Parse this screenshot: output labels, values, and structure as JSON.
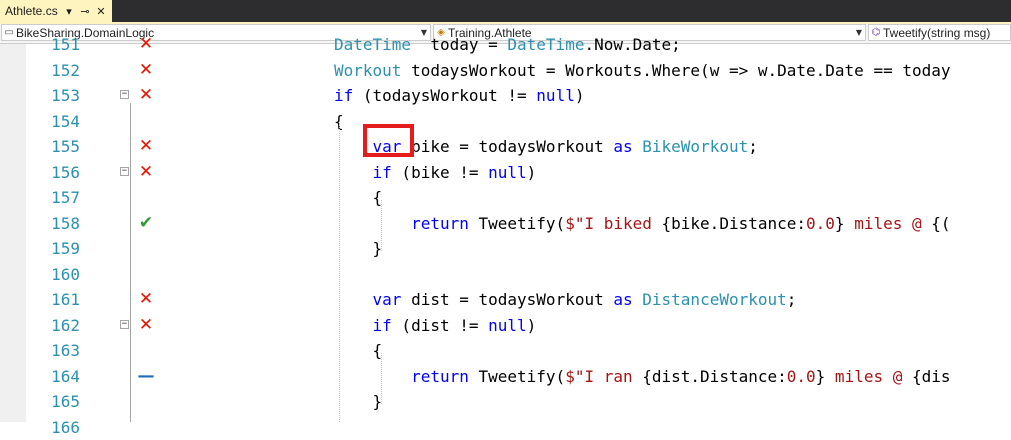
{
  "tab": {
    "title": "Athlete.cs",
    "pin_icon": "pin-icon",
    "close_icon": "close-icon"
  },
  "navbar": {
    "project": "BikeSharing.DomainLogic",
    "type": "Training.Athlete",
    "member": "Tweetify(string msg)"
  },
  "lines": [
    {
      "num": "151",
      "coverage": "x",
      "code": [
        [
          "ty",
          "DateTime"
        ],
        [
          "",
          "  today = "
        ],
        [
          "ty",
          "DateTime"
        ],
        [
          "",
          ".Now.Date;"
        ]
      ]
    },
    {
      "num": "152",
      "coverage": "x",
      "code": [
        [
          "ty",
          "Workout"
        ],
        [
          "",
          " todaysWorkout = Workouts.Where(w => w.Date.Date == today"
        ]
      ]
    },
    {
      "num": "153",
      "coverage": "x",
      "fold": "−",
      "code": [
        [
          "kw",
          "if"
        ],
        [
          "",
          " (todaysWorkout != "
        ],
        [
          "kw",
          "null"
        ],
        [
          "",
          ")"
        ]
      ]
    },
    {
      "num": "154",
      "coverage": "",
      "code": [
        [
          "",
          "{"
        ]
      ]
    },
    {
      "num": "155",
      "coverage": "x",
      "code": [
        [
          "",
          "    "
        ],
        [
          "kw",
          "var"
        ],
        [
          "",
          " bike = todaysWorkout "
        ],
        [
          "kw",
          "as"
        ],
        [
          "",
          " "
        ],
        [
          "ty",
          "BikeWorkout"
        ],
        [
          "",
          ";"
        ]
      ]
    },
    {
      "num": "156",
      "coverage": "x",
      "fold": "−",
      "code": [
        [
          "",
          "    "
        ],
        [
          "kw",
          "if"
        ],
        [
          "",
          " (bike != "
        ],
        [
          "kw",
          "null"
        ],
        [
          "",
          ")"
        ]
      ]
    },
    {
      "num": "157",
      "coverage": "",
      "code": [
        [
          "",
          "    {"
        ]
      ]
    },
    {
      "num": "158",
      "coverage": "ok",
      "code": [
        [
          "",
          "        "
        ],
        [
          "kw",
          "return"
        ],
        [
          "",
          " Tweetify("
        ],
        [
          "str",
          "$\"I biked "
        ],
        [
          "",
          "{bike.Distance:"
        ],
        [
          "str",
          "0.0"
        ],
        [
          "",
          "}"
        ],
        [
          "str",
          " miles @ "
        ],
        [
          "",
          "{("
        ]
      ]
    },
    {
      "num": "159",
      "coverage": "",
      "code": [
        [
          "",
          "    }"
        ]
      ]
    },
    {
      "num": "160",
      "coverage": "",
      "code": [
        [
          "",
          ""
        ]
      ]
    },
    {
      "num": "161",
      "coverage": "x",
      "code": [
        [
          "",
          "    "
        ],
        [
          "kw",
          "var"
        ],
        [
          "",
          " dist = todaysWorkout "
        ],
        [
          "kw",
          "as"
        ],
        [
          "",
          " "
        ],
        [
          "ty",
          "DistanceWorkout"
        ],
        [
          "",
          ";"
        ]
      ]
    },
    {
      "num": "162",
      "coverage": "x",
      "fold": "−",
      "code": [
        [
          "",
          "    "
        ],
        [
          "kw",
          "if"
        ],
        [
          "",
          " (dist != "
        ],
        [
          "kw",
          "null"
        ],
        [
          "",
          ")"
        ]
      ]
    },
    {
      "num": "163",
      "coverage": "",
      "code": [
        [
          "",
          "    {"
        ]
      ]
    },
    {
      "num": "164",
      "coverage": "part",
      "code": [
        [
          "",
          "        "
        ],
        [
          "kw",
          "return"
        ],
        [
          "",
          " Tweetify("
        ],
        [
          "str",
          "$\"I ran "
        ],
        [
          "",
          "{dist.Distance:"
        ],
        [
          "str",
          "0.0"
        ],
        [
          "",
          "}"
        ],
        [
          "str",
          " miles @ "
        ],
        [
          "",
          "{dis"
        ]
      ]
    },
    {
      "num": "165",
      "coverage": "",
      "code": [
        [
          "",
          "    }"
        ]
      ]
    },
    {
      "num": "166",
      "coverage": "",
      "code": [
        [
          "",
          ""
        ]
      ]
    }
  ],
  "coverage_glyphs": {
    "x": "✕",
    "ok": "✔",
    "part": "—"
  },
  "colors": {
    "keyword": "#0000ff",
    "type": "#2b91af",
    "string": "#a31515",
    "line_number": "#2b91af",
    "highlight_box": "#e51c1c",
    "tab_active": "#fdf4bf"
  }
}
